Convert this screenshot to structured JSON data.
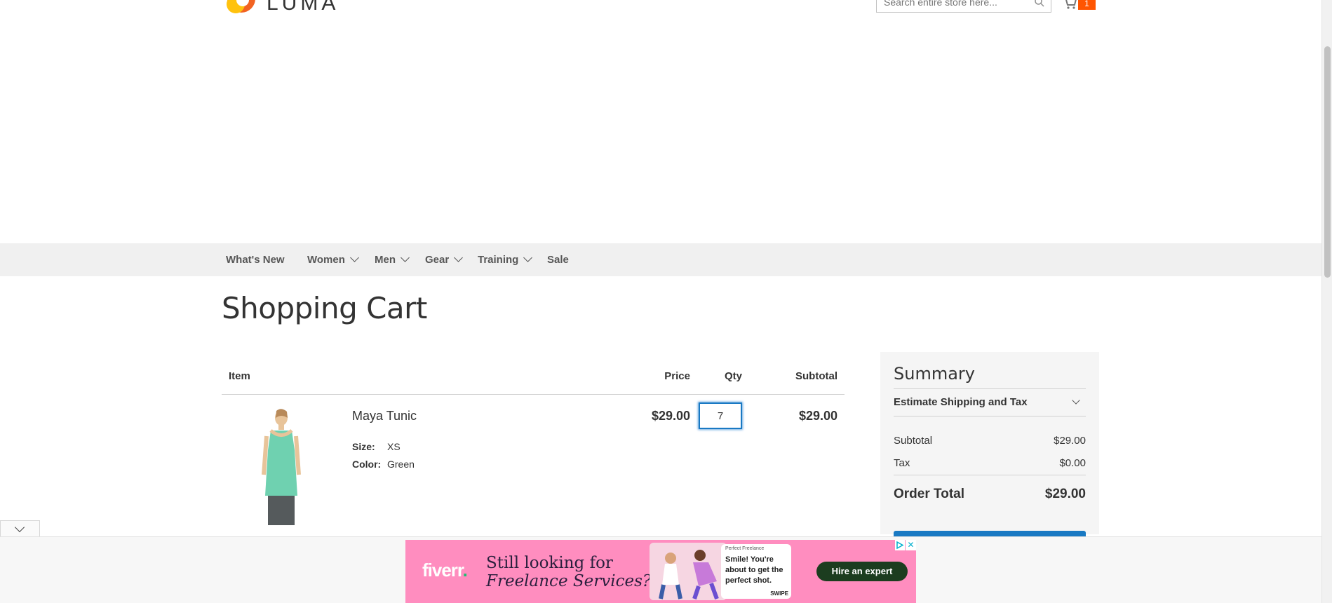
{
  "header": {
    "logo_text": "LUMA",
    "search_placeholder": "Search entire store here...",
    "cart_count": "1"
  },
  "nav": {
    "items": [
      {
        "label": "What's New",
        "has_dropdown": false
      },
      {
        "label": "Women",
        "has_dropdown": true
      },
      {
        "label": "Men",
        "has_dropdown": true
      },
      {
        "label": "Gear",
        "has_dropdown": true
      },
      {
        "label": "Training",
        "has_dropdown": true
      },
      {
        "label": "Sale",
        "has_dropdown": false
      }
    ]
  },
  "page": {
    "title": "Shopping Cart"
  },
  "cart": {
    "columns": {
      "item": "Item",
      "price": "Price",
      "qty": "Qty",
      "subtotal": "Subtotal"
    },
    "items": [
      {
        "name": "Maya Tunic",
        "options": [
          {
            "label": "Size:",
            "value": "XS"
          },
          {
            "label": "Color:",
            "value": "Green"
          }
        ],
        "price": "$29.00",
        "qty": "7",
        "subtotal": "$29.00",
        "image_color": "#6fd1b0"
      }
    ]
  },
  "summary": {
    "title": "Summary",
    "estimate_label": "Estimate Shipping and Tax",
    "subtotal_label": "Subtotal",
    "subtotal_value": "$29.00",
    "tax_label": "Tax",
    "tax_value": "$0.00",
    "order_total_label": "Order Total",
    "order_total_value": "$29.00"
  },
  "ad": {
    "brand": "fiverr",
    "headline_line1": "Still looking for",
    "headline_line2": "Freelance Services?",
    "card_small": "Perfect Freelance",
    "card_text": "Smile! You're about to get the perfect shot.",
    "card_swipe": "SWIPE",
    "cta": "Hire an expert",
    "close": "✕"
  },
  "colors": {
    "accent_blue": "#1979c3",
    "cart_badge": "#ff5501",
    "nav_bg": "#f0f0f0",
    "ad_bg": "#ff8dbf",
    "ad_cta": "#1c3d1f"
  }
}
